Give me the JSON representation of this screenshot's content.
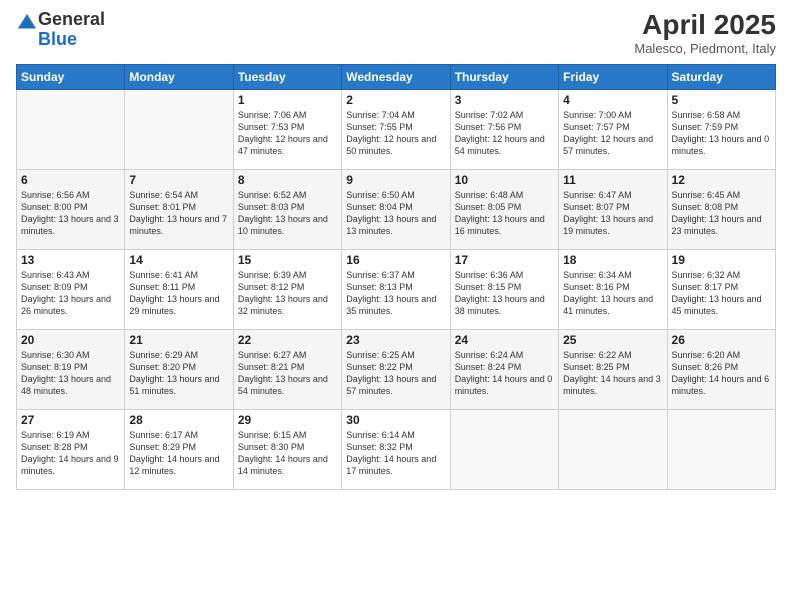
{
  "logo": {
    "general": "General",
    "blue": "Blue"
  },
  "header": {
    "month": "April 2025",
    "location": "Malesco, Piedmont, Italy"
  },
  "weekdays": [
    "Sunday",
    "Monday",
    "Tuesday",
    "Wednesday",
    "Thursday",
    "Friday",
    "Saturday"
  ],
  "weeks": [
    [
      {
        "day": "",
        "info": ""
      },
      {
        "day": "",
        "info": ""
      },
      {
        "day": "1",
        "info": "Sunrise: 7:06 AM\nSunset: 7:53 PM\nDaylight: 12 hours and 47 minutes."
      },
      {
        "day": "2",
        "info": "Sunrise: 7:04 AM\nSunset: 7:55 PM\nDaylight: 12 hours and 50 minutes."
      },
      {
        "day": "3",
        "info": "Sunrise: 7:02 AM\nSunset: 7:56 PM\nDaylight: 12 hours and 54 minutes."
      },
      {
        "day": "4",
        "info": "Sunrise: 7:00 AM\nSunset: 7:57 PM\nDaylight: 12 hours and 57 minutes."
      },
      {
        "day": "5",
        "info": "Sunrise: 6:58 AM\nSunset: 7:59 PM\nDaylight: 13 hours and 0 minutes."
      }
    ],
    [
      {
        "day": "6",
        "info": "Sunrise: 6:56 AM\nSunset: 8:00 PM\nDaylight: 13 hours and 3 minutes."
      },
      {
        "day": "7",
        "info": "Sunrise: 6:54 AM\nSunset: 8:01 PM\nDaylight: 13 hours and 7 minutes."
      },
      {
        "day": "8",
        "info": "Sunrise: 6:52 AM\nSunset: 8:03 PM\nDaylight: 13 hours and 10 minutes."
      },
      {
        "day": "9",
        "info": "Sunrise: 6:50 AM\nSunset: 8:04 PM\nDaylight: 13 hours and 13 minutes."
      },
      {
        "day": "10",
        "info": "Sunrise: 6:48 AM\nSunset: 8:05 PM\nDaylight: 13 hours and 16 minutes."
      },
      {
        "day": "11",
        "info": "Sunrise: 6:47 AM\nSunset: 8:07 PM\nDaylight: 13 hours and 19 minutes."
      },
      {
        "day": "12",
        "info": "Sunrise: 6:45 AM\nSunset: 8:08 PM\nDaylight: 13 hours and 23 minutes."
      }
    ],
    [
      {
        "day": "13",
        "info": "Sunrise: 6:43 AM\nSunset: 8:09 PM\nDaylight: 13 hours and 26 minutes."
      },
      {
        "day": "14",
        "info": "Sunrise: 6:41 AM\nSunset: 8:11 PM\nDaylight: 13 hours and 29 minutes."
      },
      {
        "day": "15",
        "info": "Sunrise: 6:39 AM\nSunset: 8:12 PM\nDaylight: 13 hours and 32 minutes."
      },
      {
        "day": "16",
        "info": "Sunrise: 6:37 AM\nSunset: 8:13 PM\nDaylight: 13 hours and 35 minutes."
      },
      {
        "day": "17",
        "info": "Sunrise: 6:36 AM\nSunset: 8:15 PM\nDaylight: 13 hours and 38 minutes."
      },
      {
        "day": "18",
        "info": "Sunrise: 6:34 AM\nSunset: 8:16 PM\nDaylight: 13 hours and 41 minutes."
      },
      {
        "day": "19",
        "info": "Sunrise: 6:32 AM\nSunset: 8:17 PM\nDaylight: 13 hours and 45 minutes."
      }
    ],
    [
      {
        "day": "20",
        "info": "Sunrise: 6:30 AM\nSunset: 8:19 PM\nDaylight: 13 hours and 48 minutes."
      },
      {
        "day": "21",
        "info": "Sunrise: 6:29 AM\nSunset: 8:20 PM\nDaylight: 13 hours and 51 minutes."
      },
      {
        "day": "22",
        "info": "Sunrise: 6:27 AM\nSunset: 8:21 PM\nDaylight: 13 hours and 54 minutes."
      },
      {
        "day": "23",
        "info": "Sunrise: 6:25 AM\nSunset: 8:22 PM\nDaylight: 13 hours and 57 minutes."
      },
      {
        "day": "24",
        "info": "Sunrise: 6:24 AM\nSunset: 8:24 PM\nDaylight: 14 hours and 0 minutes."
      },
      {
        "day": "25",
        "info": "Sunrise: 6:22 AM\nSunset: 8:25 PM\nDaylight: 14 hours and 3 minutes."
      },
      {
        "day": "26",
        "info": "Sunrise: 6:20 AM\nSunset: 8:26 PM\nDaylight: 14 hours and 6 minutes."
      }
    ],
    [
      {
        "day": "27",
        "info": "Sunrise: 6:19 AM\nSunset: 8:28 PM\nDaylight: 14 hours and 9 minutes."
      },
      {
        "day": "28",
        "info": "Sunrise: 6:17 AM\nSunset: 8:29 PM\nDaylight: 14 hours and 12 minutes."
      },
      {
        "day": "29",
        "info": "Sunrise: 6:15 AM\nSunset: 8:30 PM\nDaylight: 14 hours and 14 minutes."
      },
      {
        "day": "30",
        "info": "Sunrise: 6:14 AM\nSunset: 8:32 PM\nDaylight: 14 hours and 17 minutes."
      },
      {
        "day": "",
        "info": ""
      },
      {
        "day": "",
        "info": ""
      },
      {
        "day": "",
        "info": ""
      }
    ]
  ]
}
